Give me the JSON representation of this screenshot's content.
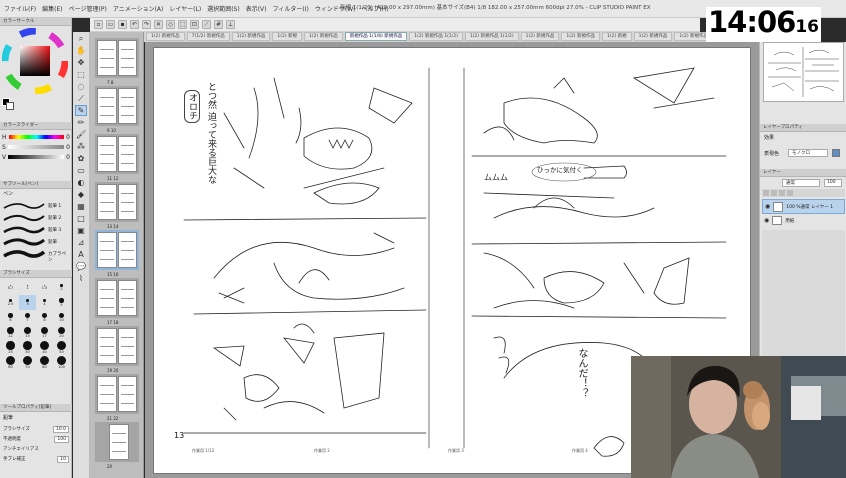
{
  "app": {
    "title": "新規 1(1/20) (420.00 x 297.00mm) 基本サイズ(B4) 1/8 182.00 x 257.00mm 600dpi 27.0% - CLIP STUDIO PAINT EX"
  },
  "menu": [
    {
      "label": "ファイル(F)"
    },
    {
      "label": "編集(E)"
    },
    {
      "label": "ページ管理(P)"
    },
    {
      "label": "アニメーション(A)"
    },
    {
      "label": "レイヤー(L)"
    },
    {
      "label": "選択範囲(S)"
    },
    {
      "label": "表示(V)"
    },
    {
      "label": "フィルター(I)"
    },
    {
      "label": "ウィンドウ(W)"
    },
    {
      "label": "ヘルプ(H)"
    }
  ],
  "clock": {
    "hm": "14:06",
    "sec": "16"
  },
  "tabs": [
    {
      "label": "1(2) 新規作品"
    },
    {
      "label": "7(1/2) 新規作品"
    },
    {
      "label": "1(2) 新規作品"
    },
    {
      "label": "1(2) 新規"
    },
    {
      "label": "1(2) 新規作品"
    },
    {
      "label": "新規作品 1(1/8) 新規作品",
      "active": true
    },
    {
      "label": "1(2) 新規作品 1(1/2)"
    },
    {
      "label": "1(2) 新規作品 1(1/2)"
    },
    {
      "label": "1(2) 新規作品"
    },
    {
      "label": "1(2) 新規作品"
    },
    {
      "label": "1(2) 新規"
    },
    {
      "label": "1(2) 新規作品"
    },
    {
      "label": "1(2) 新規作品"
    }
  ],
  "left_panel": {
    "color_wheel_title": "カラーサークル",
    "color_slider_title": "カラースライダー",
    "hsv": [
      {
        "label": "H",
        "value": "0"
      },
      {
        "label": "S",
        "value": "0"
      },
      {
        "label": "V",
        "value": "0"
      }
    ],
    "subtool_title": "サブツール[ペン]",
    "subtool_group": "ペン",
    "brushes": [
      {
        "label": "鉛筆 1"
      },
      {
        "label": "鉛筆 2"
      },
      {
        "label": "鉛筆 3"
      },
      {
        "label": "鉛筆"
      },
      {
        "label": "カブラペン"
      }
    ],
    "brushsize_title": "ブラシサイズ",
    "brush_size_values": [
      "0.7",
      "1",
      "1.5",
      "2",
      "2.5",
      "3",
      "4",
      "5",
      "6",
      "7",
      "8",
      "10",
      "12",
      "15",
      "17",
      "20",
      "25",
      "30",
      "40",
      "50",
      "60",
      "70",
      "80",
      "100"
    ],
    "tool_property_title": "ツールプロパティ[鉛筆]",
    "tool_property_subtitle": "鉛筆",
    "props": [
      {
        "label": "ブラシサイズ",
        "value": "10.0"
      },
      {
        "label": "不透明度",
        "value": "100"
      },
      {
        "label": "アンチエイリアス",
        "value": ""
      },
      {
        "label": "手ブレ補正",
        "value": "10"
      }
    ]
  },
  "page_nav": [
    {
      "pages": "7  8"
    },
    {
      "pages": "9  10"
    },
    {
      "pages": "11  12"
    },
    {
      "pages": "13  14"
    },
    {
      "pages": "15  16"
    },
    {
      "pages": "17  18"
    },
    {
      "pages": "19  20"
    },
    {
      "pages": "21  22"
    },
    {
      "pages": "20"
    }
  ],
  "canvas": {
    "page_number": "13",
    "footer_labels": [
      "作業用 1/12",
      "作業用 2",
      "作業用 3",
      "作業用 4"
    ],
    "sfx_left": [
      "とつ然 迫って来る巨大な",
      "オロチ"
    ],
    "bubble": "ひっかに気付く",
    "sfx_right_top": "ムムム",
    "sfx_right_bottom": "なんだ！？"
  },
  "right_panel": {
    "layer_property_title": "レイヤープロパティ",
    "effect_label": "効果",
    "expression_label": "表現色",
    "expression_value": "モノクロ",
    "layer_title": "レイヤー",
    "blend_mode": "通常",
    "opacity": "100",
    "layers": [
      {
        "name": "100 %通常 レイヤー 1"
      },
      {
        "name": "用紙"
      }
    ]
  },
  "colors": {
    "menu_bg": "#e8e8e8",
    "canvas_bg": "#9a9a9a",
    "selected": "#8fb5d8",
    "panel_bg": "#e4e4e4"
  }
}
